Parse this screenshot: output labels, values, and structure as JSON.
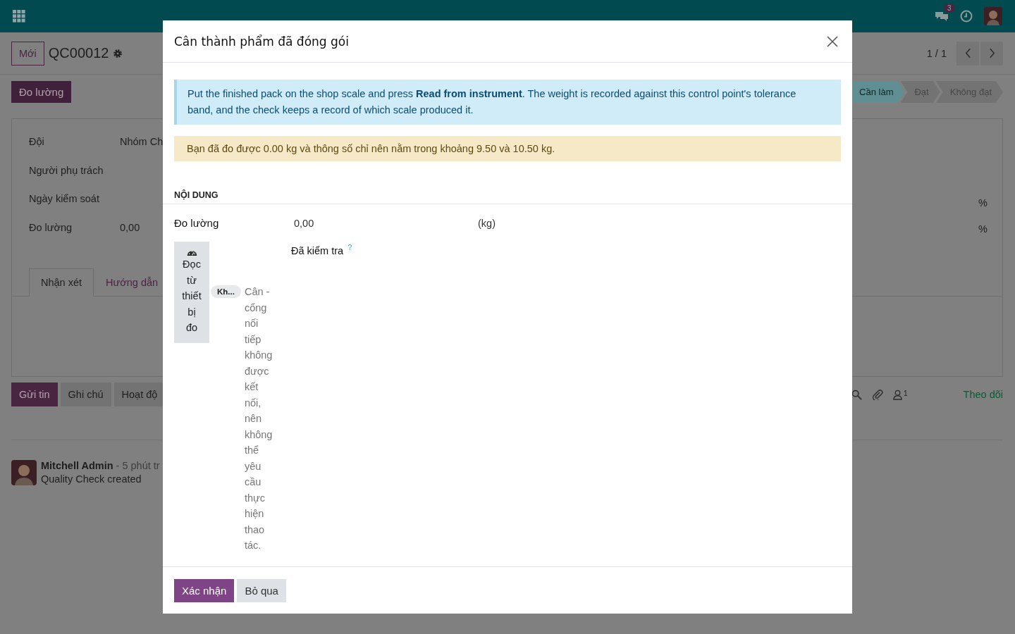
{
  "navbar": {
    "messages_badge": "3"
  },
  "control_panel": {
    "new_button": "Mới",
    "record": "QC00012",
    "pager": "1 / 1"
  },
  "action_button": "Đo lường",
  "status_bar": [
    {
      "label": "Cần làm",
      "selected": true
    },
    {
      "label": "Đạt",
      "selected": false
    },
    {
      "label": "Không đạt",
      "selected": false
    }
  ],
  "sheet": {
    "fields": [
      {
        "label": "Đội",
        "value": "Nhóm Ch"
      },
      {
        "label": "Người phụ trách"
      },
      {
        "label": "Ngày kiểm soát"
      },
      {
        "label": "Đo lường",
        "value": "0,00"
      }
    ],
    "percent_signs": [
      "%",
      "%"
    ],
    "tabs": [
      {
        "label": "Nhận xét",
        "selected": true
      },
      {
        "label": "Hướng dẫn",
        "selected": false
      }
    ]
  },
  "chatter": {
    "buttons": [
      {
        "label": "Gửi tin",
        "kind": "primary"
      },
      {
        "label": "Ghi chú",
        "kind": "secondary"
      },
      {
        "label": "Hoạt độ",
        "kind": "secondary"
      }
    ],
    "followers_count": "1",
    "follow": "Theo dõi",
    "message": {
      "author": "Mitchell Admin",
      "time": "- 5 phút tr",
      "body": "Quality Check created"
    }
  },
  "dialog": {
    "title": "Cân thành phẩm đã đóng gói",
    "info": "Put the finished pack on the shop scale and press **Read from instrument**. The weight is recorded against this control point's tolerance band, and the check keeps a record of which scale produced it.",
    "warning": "Bạn đã đo được 0.00 kg và thông số chỉ nên nằm trong khoảng 9.50 và 10.50 kg.",
    "section": "NỘI DUNG",
    "measure": {
      "label": "Đo lường",
      "value": "0,00",
      "unit": "(kg)"
    },
    "read_button": "Đọc từ thiết bị đo",
    "device_tag": "Kh...",
    "device_status": "Cân - cổng nối tiếp không được kết nối, nên không thể yêu cầu thực hiện thao tác.",
    "checked_label": "Đã kiểm tra",
    "help": "?",
    "buttons": [
      {
        "label": "Xác nhận",
        "kind": "primary"
      },
      {
        "label": "Bỏ qua",
        "kind": "secondary"
      }
    ]
  }
}
